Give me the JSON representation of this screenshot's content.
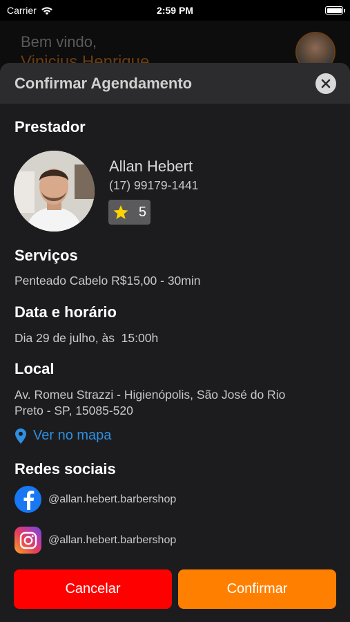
{
  "status_bar": {
    "carrier": "Carrier",
    "time": "2:59 PM"
  },
  "background": {
    "welcome": "Bem vindo,",
    "user_name": "Vinicius Henrique"
  },
  "modal": {
    "title": "Confirmar Agendamento",
    "provider_section": "Prestador",
    "provider": {
      "name": "Allan Hebert",
      "phone": "(17) 99179-1441",
      "rating": "5"
    },
    "services_section": "Serviços",
    "service": "Penteado Cabelo R$15,00 - 30min",
    "datetime_section": "Data e horário",
    "datetime": "Dia 29 de julho, às  15:00h",
    "location_section": "Local",
    "address_line1": "Av. Romeu Strazzi - Higienópolis, São José do Rio",
    "address_line2": "Preto - SP, 15085-520",
    "map_link": "Ver no mapa",
    "social_section": "Redes sociais",
    "social": [
      {
        "network": "facebook-icon",
        "handle": "@allan.hebert.barbershop"
      },
      {
        "network": "instagram-icon",
        "handle": "@allan.hebert.barbershop"
      }
    ],
    "cancel_label": "Cancelar",
    "confirm_label": "Confirmar"
  },
  "colors": {
    "cancel": "#ff0000",
    "confirm": "#ff8000",
    "link": "#2f8fe0",
    "sheet": "#1c1c1e",
    "header": "#2c2c2e"
  }
}
